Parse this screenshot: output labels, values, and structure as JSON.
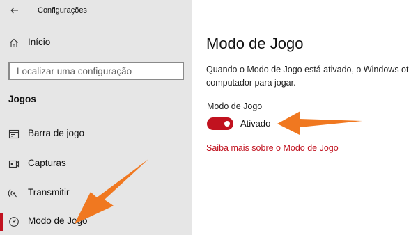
{
  "window": {
    "title": "Configurações"
  },
  "sidebar": {
    "home_label": "Início",
    "search": {
      "placeholder": "Localizar uma configuração"
    },
    "section_title": "Jogos",
    "items": [
      {
        "label": "Barra de jogo",
        "icon": "game-bar-icon"
      },
      {
        "label": "Capturas",
        "icon": "capture-icon"
      },
      {
        "label": "Transmitir",
        "icon": "broadcast-icon"
      },
      {
        "label": "Modo de Jogo",
        "icon": "game-mode-icon",
        "selected": true
      }
    ]
  },
  "main": {
    "title": "Modo de Jogo",
    "description_line1": "Quando o Modo de Jogo está ativado, o Windows ot",
    "description_line2": "computador para jogar.",
    "setting_label": "Modo de Jogo",
    "toggle": {
      "state": true,
      "state_label": "Ativado"
    },
    "link": "Saiba mais sobre o Modo de Jogo"
  },
  "colors": {
    "accent": "#c1121f",
    "annotation_arrow": "#f07820",
    "sidebar_bg": "#e6e6e6"
  }
}
